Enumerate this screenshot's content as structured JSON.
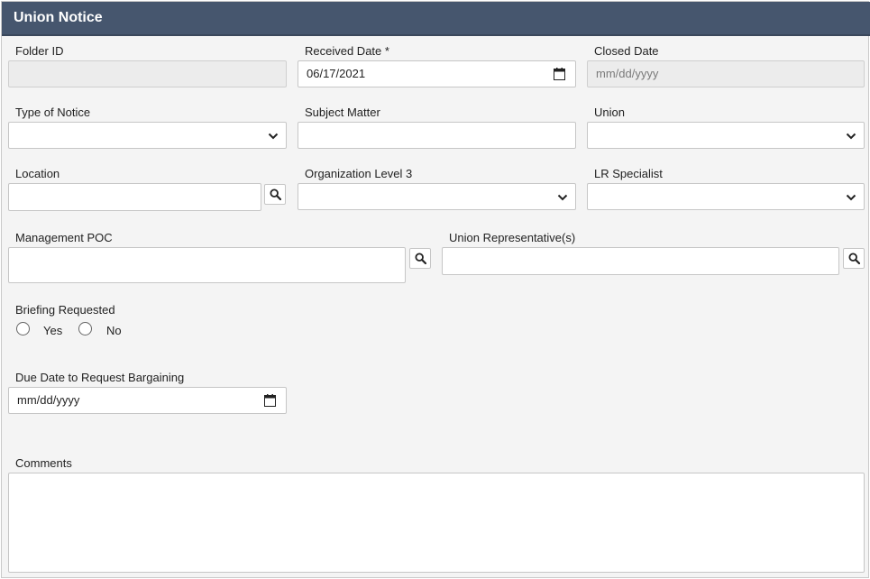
{
  "header": {
    "title": "Union Notice"
  },
  "fields": {
    "folder_id": {
      "label": "Folder ID",
      "value": ""
    },
    "received_date": {
      "label": "Received Date *",
      "value": "06/17/2021"
    },
    "closed_date": {
      "label": "Closed Date",
      "placeholder": "mm/dd/yyyy"
    },
    "type_of_notice": {
      "label": "Type of Notice",
      "value": ""
    },
    "subject_matter": {
      "label": "Subject Matter",
      "value": ""
    },
    "union": {
      "label": "Union",
      "value": ""
    },
    "location": {
      "label": "Location",
      "value": ""
    },
    "org_level_3": {
      "label": "Organization Level 3",
      "value": ""
    },
    "lr_specialist": {
      "label": "LR Specialist",
      "value": ""
    },
    "management_poc": {
      "label": "Management POC",
      "value": ""
    },
    "union_reps": {
      "label": "Union Representative(s)",
      "value": ""
    },
    "briefing_requested": {
      "label": "Briefing Requested",
      "options": [
        "Yes",
        "No"
      ]
    },
    "due_date_bargaining": {
      "label": "Due Date to Request Bargaining",
      "placeholder": "mm/dd/yyyy"
    },
    "comments": {
      "label": "Comments",
      "value": ""
    }
  }
}
